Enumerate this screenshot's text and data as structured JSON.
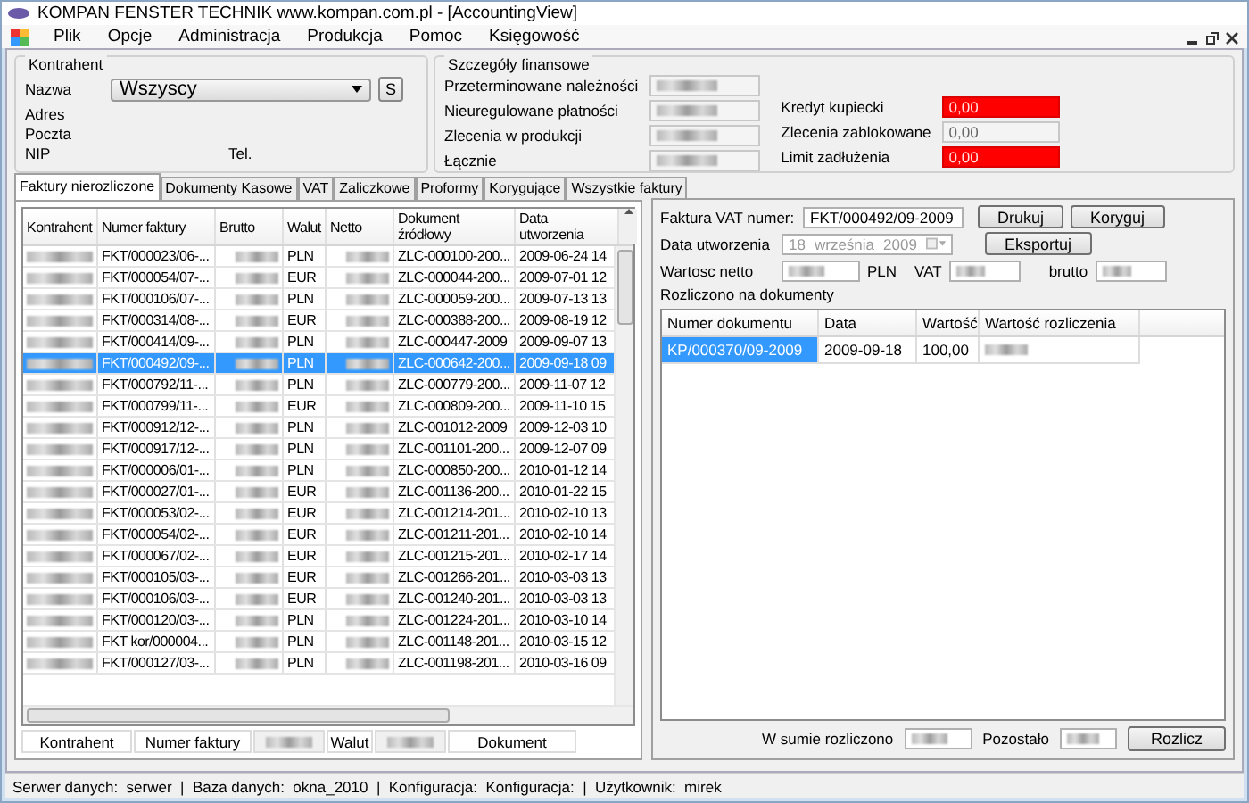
{
  "window": {
    "title": "KOMPAN FENSTER TECHNIK www.kompan.com.pl - [AccountingView]"
  },
  "menu": [
    "Plik",
    "Opcje",
    "Administracja",
    "Produkcja",
    "Pomoc",
    "Księgowość"
  ],
  "contractor": {
    "title": "Kontrahent",
    "name_label": "Nazwa",
    "name_value": "Wszyscy",
    "search_button": "S",
    "address_label": "Adres",
    "post_label": "Poczta",
    "nip_label": "NIP",
    "phone_label": "Tel."
  },
  "finance": {
    "title": "Szczegóły finansowe",
    "fields": [
      {
        "label": "Przeterminowane należności",
        "blurred": true
      },
      {
        "label": "Nieuregulowane płatności",
        "blurred": true
      },
      {
        "label": "Zlecenia w produkcji",
        "blurred": true
      },
      {
        "label": "Łącznie",
        "blurred": true
      }
    ],
    "limits": [
      {
        "label": "Kredyt kupiecki",
        "value": "0,00",
        "alert": true
      },
      {
        "label": "Zlecenia zablokowane",
        "value": "0,00",
        "alert": false
      },
      {
        "label": "Limit zadłużenia",
        "value": "0,00",
        "alert": true
      }
    ]
  },
  "tabs": [
    {
      "label": "Faktury nierozliczone",
      "selected": true
    },
    {
      "label": "Dokumenty Kasowe",
      "selected": false
    },
    {
      "label": "VAT",
      "selected": false
    },
    {
      "label": "Zaliczkowe",
      "selected": false
    },
    {
      "label": "Proformy",
      "selected": false
    },
    {
      "label": "Korygujące",
      "selected": false
    },
    {
      "label": "Wszystkie faktury",
      "selected": false
    }
  ],
  "table": {
    "columns": [
      "Kontrahent",
      "Numer faktury",
      "Brutto",
      "Walut",
      "Netto",
      "Dokument źródłowy",
      "Data utworzenia"
    ],
    "rows": [
      {
        "invoice": "FKT/000023/06-...",
        "currency": "PLN",
        "source": "ZLC-000100-200...",
        "date": "2009-06-24 14",
        "selected": false
      },
      {
        "invoice": "FKT/000054/07-...",
        "currency": "EUR",
        "source": "ZLC-000044-200...",
        "date": "2009-07-01 12",
        "selected": false
      },
      {
        "invoice": "FKT/000106/07-...",
        "currency": "PLN",
        "source": "ZLC-000059-200...",
        "date": "2009-07-13 13",
        "selected": false
      },
      {
        "invoice": "FKT/000314/08-...",
        "currency": "EUR",
        "source": "ZLC-000388-200...",
        "date": "2009-08-19 12",
        "selected": false
      },
      {
        "invoice": "FKT/000414/09-...",
        "currency": "PLN",
        "source": "ZLC-000447-2009",
        "date": "2009-09-07 13",
        "selected": false
      },
      {
        "invoice": "FKT/000492/09-...",
        "currency": "PLN",
        "source": "ZLC-000642-200...",
        "date": "2009-09-18 09",
        "selected": true
      },
      {
        "invoice": "FKT/000792/11-...",
        "currency": "PLN",
        "source": "ZLC-000779-200...",
        "date": "2009-11-07 12",
        "selected": false
      },
      {
        "invoice": "FKT/000799/11-...",
        "currency": "EUR",
        "source": "ZLC-000809-200...",
        "date": "2009-11-10 15",
        "selected": false
      },
      {
        "invoice": "FKT/000912/12-...",
        "currency": "PLN",
        "source": "ZLC-001012-2009",
        "date": "2009-12-03 10",
        "selected": false
      },
      {
        "invoice": "FKT/000917/12-...",
        "currency": "PLN",
        "source": "ZLC-001101-200...",
        "date": "2009-12-07 09",
        "selected": false
      },
      {
        "invoice": "FKT/000006/01-...",
        "currency": "PLN",
        "source": "ZLC-000850-200...",
        "date": "2010-01-12 14",
        "selected": false
      },
      {
        "invoice": "FKT/000027/01-...",
        "currency": "EUR",
        "source": "ZLC-001136-200...",
        "date": "2010-01-22 15",
        "selected": false
      },
      {
        "invoice": "FKT/000053/02-...",
        "currency": "EUR",
        "source": "ZLC-001214-201...",
        "date": "2010-02-10 13",
        "selected": false
      },
      {
        "invoice": "FKT/000054/02-...",
        "currency": "EUR",
        "source": "ZLC-001211-201...",
        "date": "2010-02-10 14",
        "selected": false
      },
      {
        "invoice": "FKT/000067/02-...",
        "currency": "EUR",
        "source": "ZLC-001215-201...",
        "date": "2010-02-17 14",
        "selected": false
      },
      {
        "invoice": "FKT/000105/03-...",
        "currency": "EUR",
        "source": "ZLC-001266-201...",
        "date": "2010-03-03 13",
        "selected": false
      },
      {
        "invoice": "FKT/000106/03-...",
        "currency": "EUR",
        "source": "ZLC-001240-201...",
        "date": "2010-03-03 13",
        "selected": false
      },
      {
        "invoice": "FKT/000120/03-...",
        "currency": "PLN",
        "source": "ZLC-001224-201...",
        "date": "2010-03-10 14",
        "selected": false
      },
      {
        "invoice": "FKT kor/000004...",
        "currency": "PLN",
        "source": "ZLC-001148-201...",
        "date": "2010-03-15 12",
        "selected": false
      },
      {
        "invoice": "FKT/000127/03-...",
        "currency": "PLN",
        "source": "ZLC-001198-201...",
        "date": "2010-03-16 09",
        "selected": false
      }
    ]
  },
  "filters": [
    {
      "label": "Kontrahent",
      "blurred": false
    },
    {
      "label": "Numer faktury",
      "blurred": false
    },
    {
      "blurred": true
    },
    {
      "label": "Walut",
      "blurred": false
    },
    {
      "blurred": true
    },
    {
      "label": "Dokument",
      "blurred": false
    }
  ],
  "details": {
    "invoice_label": "Faktura VAT numer:",
    "invoice_value": "FKT/000492/09-2009",
    "print_button": "Drukuj",
    "correct_button": "Koryguj",
    "date_label": "Data utworzenia",
    "date_day": "18",
    "date_month": "września",
    "date_year": "2009",
    "export_button": "Eksportuj",
    "net_label": "Wartosc netto",
    "currency": "PLN",
    "vat_label": "VAT",
    "gross_label": "brutto"
  },
  "settlements": {
    "title": "Rozliczono na dokumenty",
    "columns": [
      "Numer dokumentu",
      "Data",
      "Wartość",
      "Wartość rozliczenia"
    ],
    "rows": [
      {
        "number": "KP/000370/09-2009",
        "date": "2009-09-18",
        "value": "100,00",
        "selected": true
      }
    ]
  },
  "footer": {
    "total_label": "W sumie rozliczono",
    "remaining_label": "Pozostało",
    "settle_button": "Rozlicz"
  },
  "status_bar": "Serwer danych:  serwer  |  Baza danych:  okna_2010  |  Konfiguracja:  Konfiguracja:  |  Użytkownik:  mirek"
}
